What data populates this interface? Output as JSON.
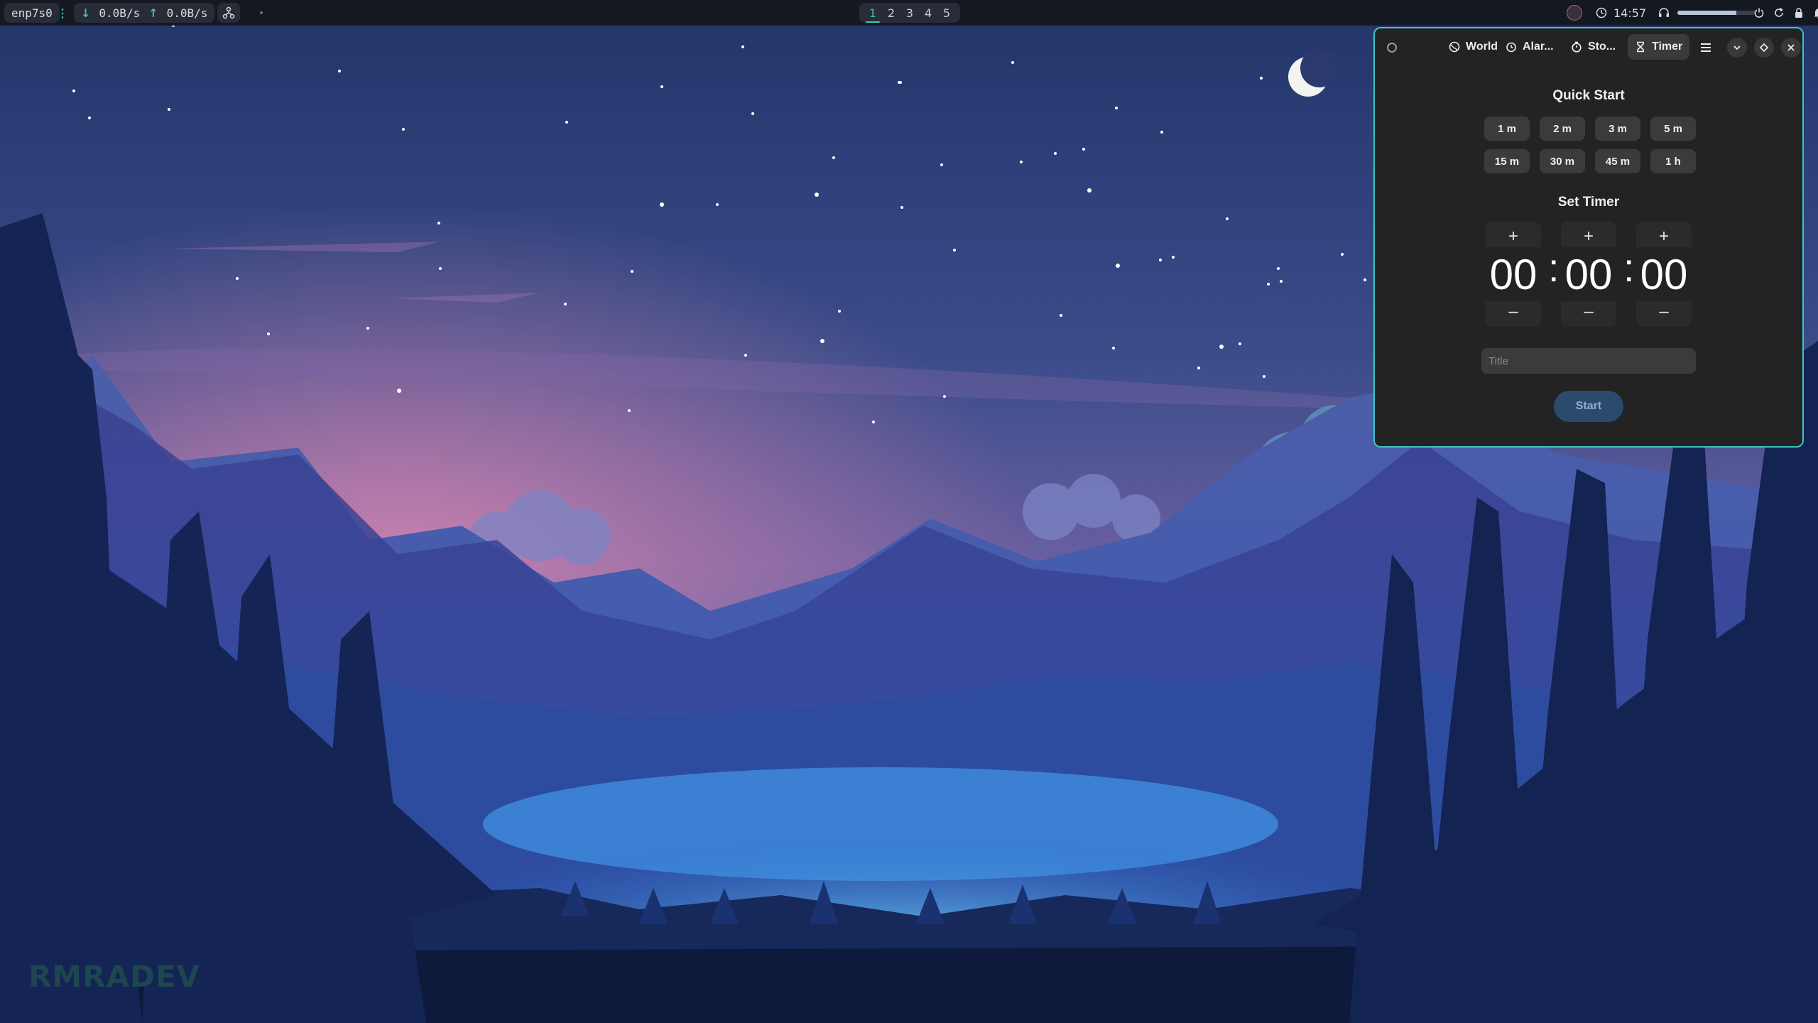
{
  "topbar": {
    "interface": "enp7s0",
    "separator": "⋮",
    "download_speed": "0.0B/s",
    "upload_speed": "0.0B/s",
    "workspaces": [
      "1",
      "2",
      "3",
      "4",
      "5"
    ],
    "active_workspace": "1",
    "clock": "14:57",
    "volume_level": 0.75
  },
  "wallpaper": {
    "watermark": "RMRADEV"
  },
  "clocks_window": {
    "tabs": {
      "world": "World",
      "alarm": "Alar...",
      "stopwatch": "Sto...",
      "timer": "Timer"
    },
    "active_tab": "timer",
    "quick_start": {
      "title": "Quick Start",
      "presets": [
        "1 m",
        "2 m",
        "3 m",
        "5 m",
        "15 m",
        "30 m",
        "45 m",
        "1 h"
      ]
    },
    "set_timer": {
      "title": "Set Timer",
      "hours": "00",
      "minutes": "00",
      "seconds": "00",
      "separator": ":",
      "increment": "+",
      "decrement": "–"
    },
    "title_placeholder": "Title",
    "start_label": "Start"
  },
  "colors": {
    "accent": "#3fc3c0",
    "window_bg": "#232323",
    "button_bg": "#3b3b3b",
    "start_bg": "#2a4a6e",
    "topbar_bg": "#141820"
  }
}
